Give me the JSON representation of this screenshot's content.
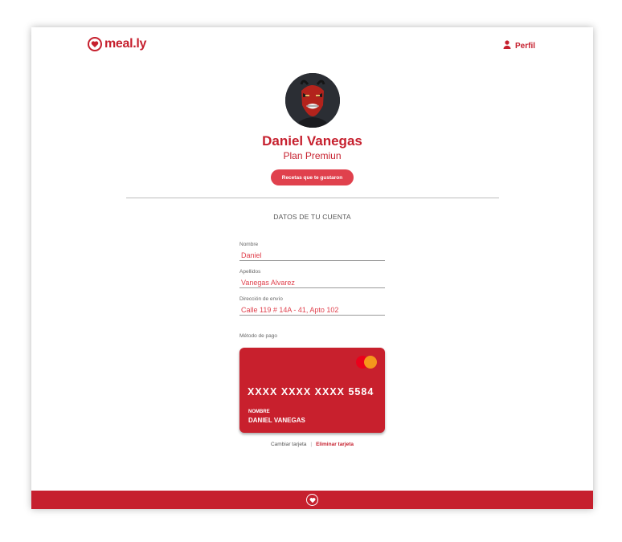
{
  "header": {
    "logo_text": "meal.ly",
    "profile_label": "Perfil"
  },
  "user": {
    "name": "Daniel Vanegas",
    "plan": "Plan Premiun",
    "liked_recipes_button": "Recetas que te gustaron"
  },
  "account": {
    "section_title": "DATOS DE TU CUENTA",
    "fields": [
      {
        "label": "Nombre",
        "value": "Daniel"
      },
      {
        "label": "Apellidos",
        "value": "Vanegas Alvarez"
      },
      {
        "label": "Dirección de envío",
        "value": "Calle 119 # 14A - 41, Apto 102"
      }
    ],
    "payment_label": "Método de pago"
  },
  "card": {
    "brand_icon": "mastercard-icon",
    "number": "XXXX  XXXX  XXXX  5584",
    "holder_label": "NOMBRE",
    "holder_name": "DANIEL VANEGAS",
    "change_label": "Cambiar tarjeta",
    "separator": "|",
    "delete_label": "Eliminar tarjeta"
  },
  "colors": {
    "brand_red": "#c6202e",
    "accent_red": "#e0414d",
    "card_red": "#c8202d"
  }
}
